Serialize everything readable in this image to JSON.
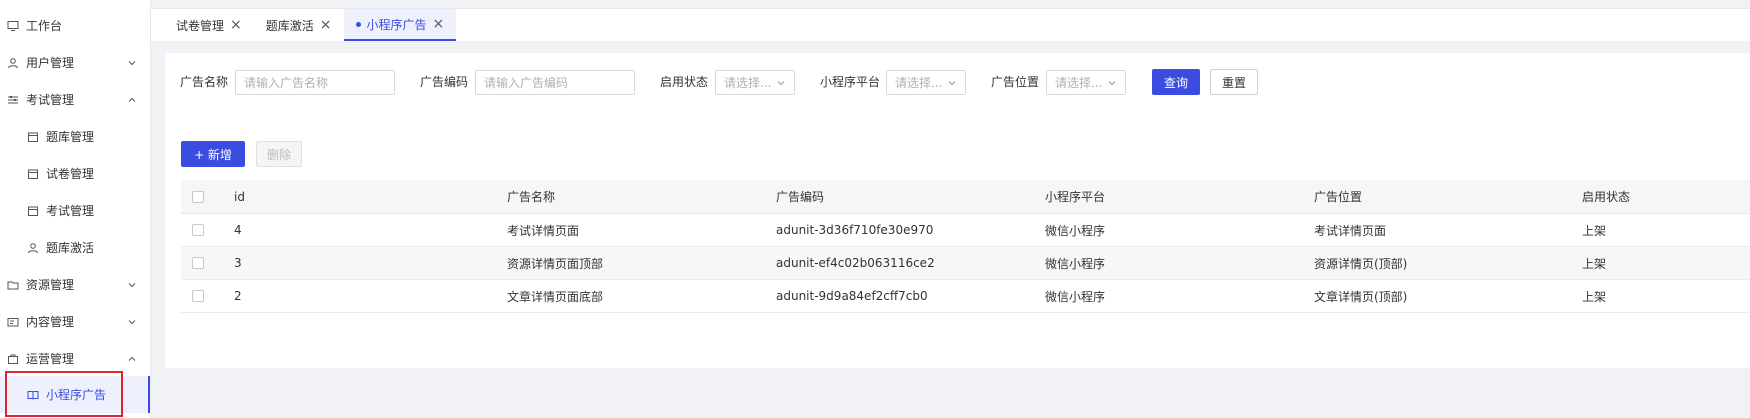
{
  "sidebar": {
    "items": [
      {
        "label": "工作台",
        "icon": "monitor-icon",
        "level": "top"
      },
      {
        "label": "用户管理",
        "icon": "user-icon",
        "level": "top",
        "arrow": "down"
      },
      {
        "label": "考试管理",
        "icon": "sliders-icon",
        "level": "top",
        "arrow": "up"
      },
      {
        "label": "题库管理",
        "icon": "calendar-icon",
        "level": "sub"
      },
      {
        "label": "试卷管理",
        "icon": "calendar-icon",
        "level": "sub"
      },
      {
        "label": "考试管理",
        "icon": "calendar-icon",
        "level": "sub"
      },
      {
        "label": "题库激活",
        "icon": "user-icon",
        "level": "sub"
      },
      {
        "label": "资源管理",
        "icon": "folder-icon",
        "level": "top",
        "arrow": "down"
      },
      {
        "label": "内容管理",
        "icon": "card-icon",
        "level": "top",
        "arrow": "down"
      },
      {
        "label": "运营管理",
        "icon": "bag-icon",
        "level": "top",
        "arrow": "up"
      },
      {
        "label": "小程序广告",
        "icon": "book-icon",
        "level": "sub",
        "active": true
      }
    ]
  },
  "tabs": [
    {
      "label": "试卷管理",
      "active": false
    },
    {
      "label": "题库激活",
      "active": false
    },
    {
      "label": "小程序广告",
      "active": true
    }
  ],
  "filters": {
    "ad_name_label": "广告名称",
    "ad_name_placeholder": "请输入广告名称",
    "ad_code_label": "广告编码",
    "ad_code_placeholder": "请输入广告编码",
    "status_label": "启用状态",
    "status_placeholder": "请选择...",
    "platform_label": "小程序平台",
    "platform_placeholder": "请选择...",
    "position_label": "广告位置",
    "position_placeholder": "请选择...",
    "query_label": "查询",
    "reset_label": "重置"
  },
  "toolbar": {
    "add_label": "+ 新增",
    "delete_label": "删除"
  },
  "table": {
    "columns": [
      "id",
      "广告名称",
      "广告编码",
      "小程序平台",
      "广告位置",
      "启用状态"
    ],
    "rows": [
      [
        "4",
        "考试详情页面",
        "adunit-3d36f710fe30e970",
        "微信小程序",
        "考试详情页面",
        "上架"
      ],
      [
        "3",
        "资源详情页面顶部",
        "adunit-ef4c02b063116ce2",
        "微信小程序",
        "资源详情页(顶部)",
        "上架"
      ],
      [
        "2",
        "文章详情页面底部",
        "adunit-9d9a84ef2cff7cb0",
        "微信小程序",
        "文章详情页(顶部)",
        "上架"
      ]
    ]
  },
  "colors": {
    "primary": "#3a4de0",
    "highlight_box": "#e0242f"
  }
}
